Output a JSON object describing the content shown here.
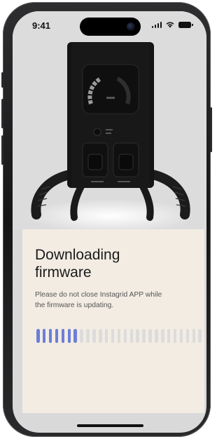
{
  "status_bar": {
    "time": "9:41",
    "icons": [
      "signal-icon",
      "wifi-icon",
      "battery-icon"
    ]
  },
  "product_image": {
    "icon": "power-station-icon"
  },
  "update": {
    "title_line1": "Downloading",
    "title_line2": "firmware",
    "message_line1": "Please do not close Instagrid APP while",
    "message_line2": "the firmware is updating.",
    "progress": {
      "total_segments": 27,
      "filled_segments": 7,
      "fraction": 0.26,
      "filled_color": "#6b7fd7",
      "empty_color": "#dcdcdc"
    }
  },
  "colors": {
    "card_background": "#f3ece3",
    "device_body": "#141414"
  }
}
